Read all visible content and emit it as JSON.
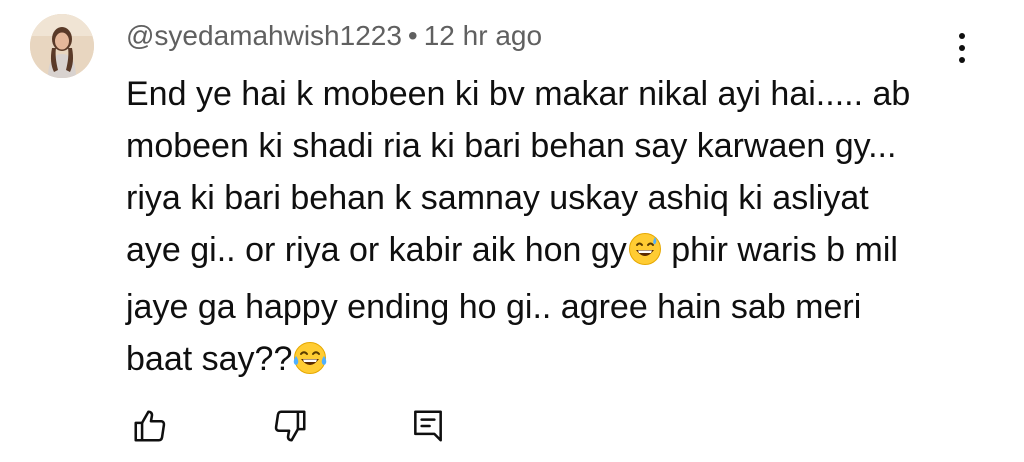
{
  "comment": {
    "author": "@syedamahwish1223",
    "separator": "•",
    "time": "12 hr ago",
    "text_lines": [
      "End ye hai k mobeen ki bv makar nikal ayi hai..... ab",
      "mobeen ki shadi ria ki bari behan say karwaen gy...",
      "riya ki bari behan k samnay uskay ashiq ki asliyat",
      "aye gi.. or riya or kabir aik hon gy",
      " phir waris b mil",
      "jaye ga happy ending ho gi.. agree hain sab meri",
      "baat say??"
    ],
    "emojis": [
      "grinning-sweat-emoji",
      "tears-of-joy-emoji"
    ]
  },
  "icons": {
    "avatar": "avatar",
    "menu": "more-vert-icon",
    "like": "thumb-up-icon",
    "dislike": "thumb-down-icon",
    "reply": "comment-reply-icon"
  },
  "colors": {
    "meta_text": "#606060",
    "body_text": "#0f0f0f",
    "emoji_face": "#ffcc33"
  }
}
